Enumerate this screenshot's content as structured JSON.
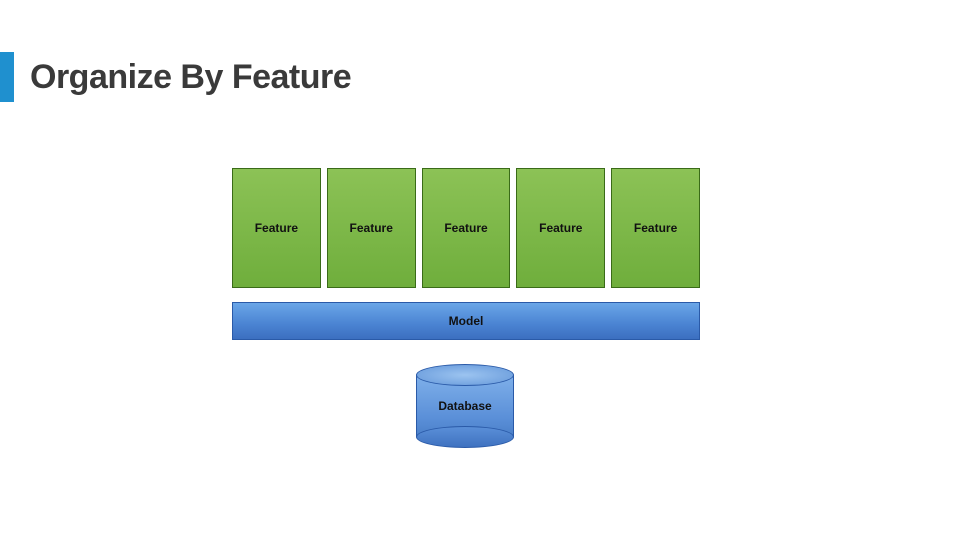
{
  "title": "Organize By Feature",
  "features": {
    "items": [
      {
        "label": "Feature"
      },
      {
        "label": "Feature"
      },
      {
        "label": "Feature"
      },
      {
        "label": "Feature"
      },
      {
        "label": "Feature"
      }
    ]
  },
  "model": {
    "label": "Model"
  },
  "database": {
    "label": "Database"
  },
  "colors": {
    "accent": "#1f90cf",
    "feature_fill": "#7db848",
    "model_fill": "#4a83d2",
    "db_fill": "#5a8fd8"
  }
}
